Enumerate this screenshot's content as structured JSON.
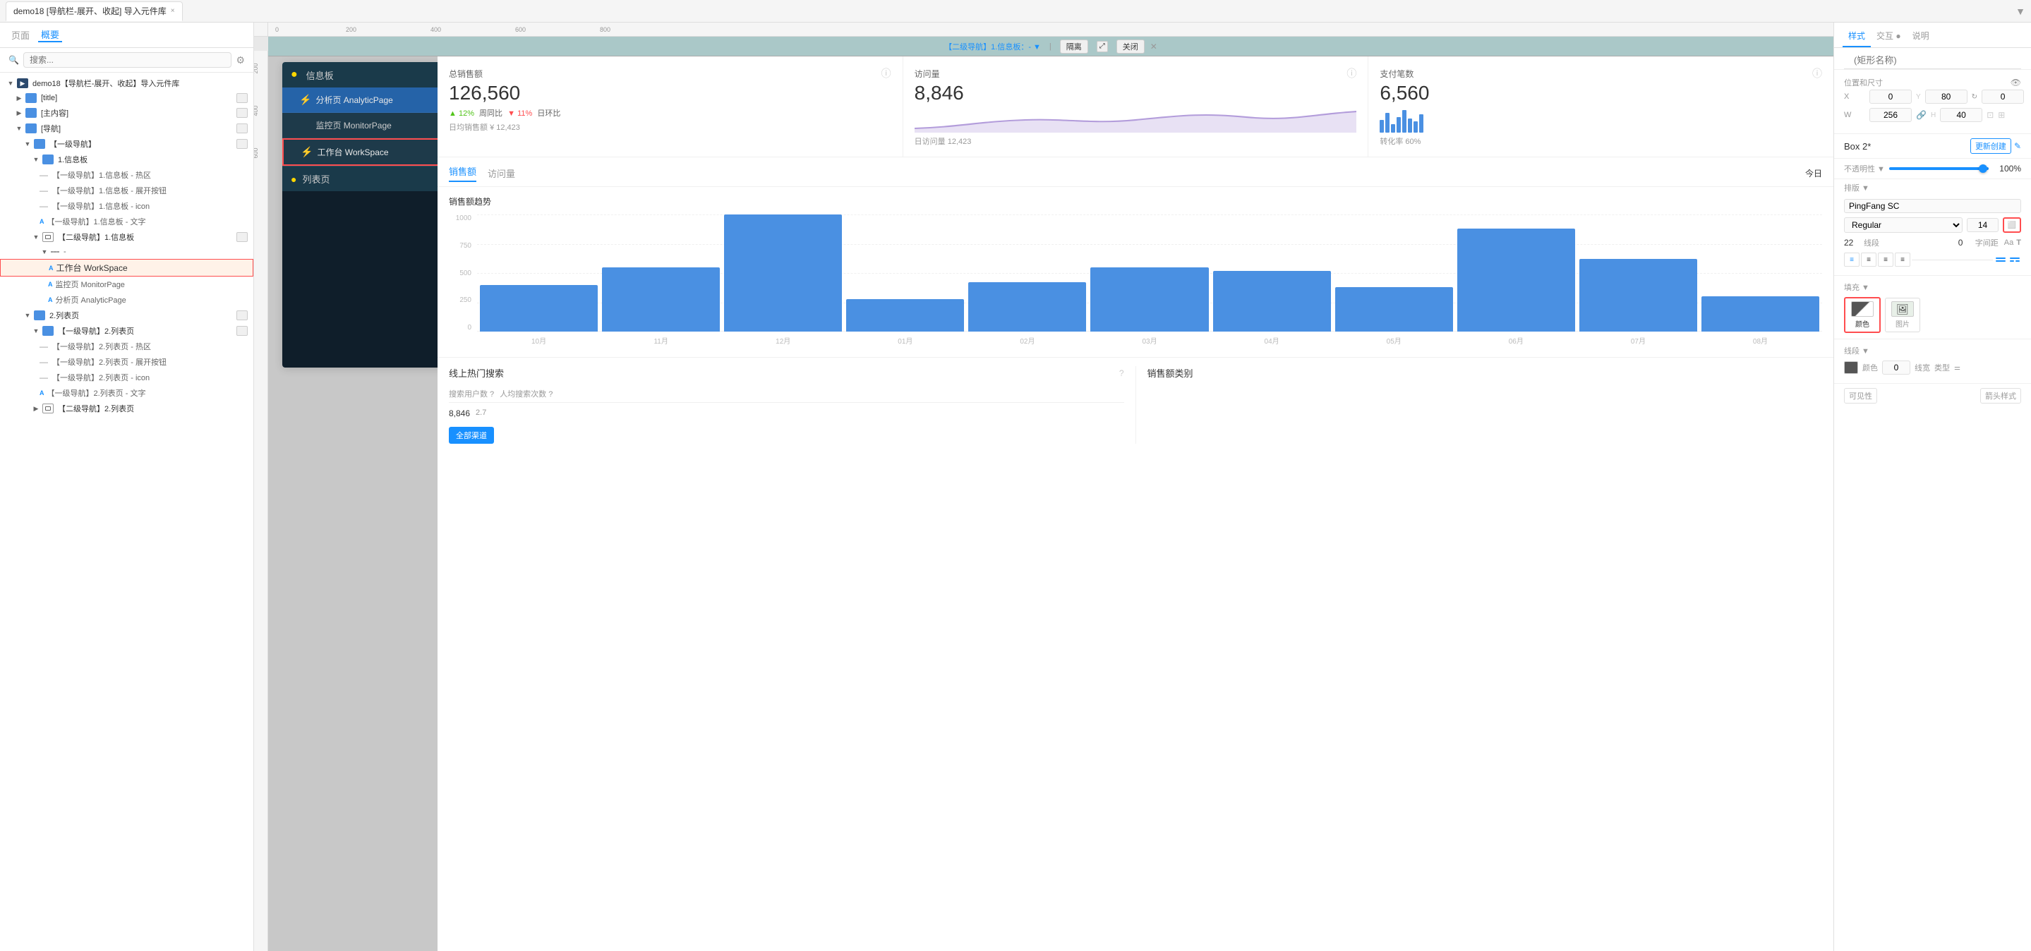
{
  "tabs": {
    "items": [
      {
        "label": "demo18 [导航栏-展开、收起] 导入元件库",
        "active": true
      }
    ],
    "close_label": "×",
    "arrow_label": "▼"
  },
  "left_panel": {
    "tabs": [
      "页面",
      "概要"
    ],
    "active_tab": "概要",
    "search_placeholder": "搜索...",
    "tree": [
      {
        "id": "root",
        "indent": 0,
        "type": "folder",
        "label": "demo18【导航栏-展开、收起】导入元件库",
        "expanded": true,
        "has_badge": true
      },
      {
        "id": "title",
        "indent": 1,
        "type": "folder",
        "label": "[title]",
        "expanded": false,
        "has_badge": true
      },
      {
        "id": "main",
        "indent": 1,
        "type": "folder",
        "label": "[主内容]",
        "expanded": false,
        "has_badge": true
      },
      {
        "id": "nav",
        "indent": 1,
        "type": "folder",
        "label": "[导航]",
        "expanded": true,
        "has_badge": true
      },
      {
        "id": "nav1",
        "indent": 2,
        "type": "folder",
        "label": "【一级导航】",
        "expanded": true,
        "has_badge": true
      },
      {
        "id": "nav1-info",
        "indent": 3,
        "type": "folder",
        "label": "1.信息板",
        "expanded": true,
        "has_badge": false
      },
      {
        "id": "nav1-info-hotzone",
        "indent": 4,
        "type": "item",
        "label": "【一级导航】1.信息板 - 热区"
      },
      {
        "id": "nav1-info-expand",
        "indent": 4,
        "type": "item",
        "label": "【一级导航】1.信息板 - 展开按钮"
      },
      {
        "id": "nav1-info-icon",
        "indent": 4,
        "type": "item",
        "label": "【一级导航】1.信息板 - icon"
      },
      {
        "id": "nav1-info-text",
        "indent": 4,
        "type": "text",
        "label": "【一级导航】1.信息板 - 文字"
      },
      {
        "id": "nav2-info",
        "indent": 3,
        "type": "compound",
        "label": "【二级导航】1.信息板",
        "expanded": true
      },
      {
        "id": "nav2-info-dash",
        "indent": 4,
        "type": "dash",
        "label": "-"
      },
      {
        "id": "ws",
        "indent": 5,
        "type": "text-selected",
        "label": "工作台 WorkSpace",
        "selected": true
      },
      {
        "id": "monitor",
        "indent": 5,
        "type": "text",
        "label": "监控页 MonitorPage"
      },
      {
        "id": "analytic",
        "indent": 5,
        "type": "text",
        "label": "分析页 AnalyticPage"
      },
      {
        "id": "list-section",
        "indent": 2,
        "type": "folder",
        "label": "2.列表页",
        "expanded": true,
        "has_badge": true
      },
      {
        "id": "nav1-list",
        "indent": 3,
        "type": "folder",
        "label": "【一级导航】2.列表页",
        "expanded": true,
        "has_badge": true
      },
      {
        "id": "nav1-list-hotzone",
        "indent": 4,
        "type": "item",
        "label": "【一级导航】2.列表页 - 热区"
      },
      {
        "id": "nav1-list-expand",
        "indent": 4,
        "type": "item",
        "label": "【一级导航】2.列表页 - 展开按钮"
      },
      {
        "id": "nav1-list-icon",
        "indent": 4,
        "type": "item",
        "label": "【一级导航】2.列表页 - icon"
      },
      {
        "id": "nav1-list-text",
        "indent": 4,
        "type": "text",
        "label": "【一级导航】2.列表页 - 文字"
      },
      {
        "id": "nav2-list",
        "indent": 3,
        "type": "compound",
        "label": "【二级导航】2.列表页"
      }
    ]
  },
  "canvas": {
    "ruler_marks": [
      "0",
      "200",
      "400",
      "600",
      "800"
    ],
    "info_bar_title": "【二级导航】1.信息板：- ▼",
    "isolate_btn": "隔离",
    "close_btn": "关闭"
  },
  "nav_preview": {
    "header": {
      "icon": "⚡",
      "title": "信息板",
      "arrow": "∧"
    },
    "analytic": {
      "text": "分析页 AnalyticPage",
      "badge": "⚡"
    },
    "monitor": {
      "text": "监控页 MonitorPage"
    },
    "workspace": {
      "text": "工作台 WorkSpace",
      "badge": "⚡"
    },
    "list_header": {
      "icon": "⚡",
      "title": "列表页",
      "arrow": "∨"
    },
    "sub_items": [
      {
        "text": "分析页 AnalyticPage"
      },
      {
        "text": "监控页 MonitorPage"
      },
      {
        "text": "工作台 WorkSpace"
      }
    ]
  },
  "stats": [
    {
      "name": "总销售额",
      "value": "126,560",
      "change_up": "12%",
      "change_label": "周同比",
      "change_down": "11%",
      "change_label2": "日环比",
      "sub": "日均销售额",
      "sub_val": "¥ 12,423"
    },
    {
      "name": "访问量",
      "value": "8,846",
      "sub": "日访问量",
      "sub_val": "12,423"
    },
    {
      "name": "支付笔数",
      "value": "6,560",
      "sub": "转化率",
      "sub_val": "60%"
    }
  ],
  "chart": {
    "tabs": [
      "销售额",
      "访问量"
    ],
    "active_tab": "销售额",
    "today_label": "今日",
    "title": "销售额趋势",
    "bars": [
      {
        "month": "10月",
        "height": 40
      },
      {
        "month": "11月",
        "height": 55
      },
      {
        "month": "12月",
        "height": 100
      },
      {
        "month": "01月",
        "height": 28
      },
      {
        "month": "02月",
        "height": 42
      },
      {
        "month": "03月",
        "height": 55
      },
      {
        "month": "04月",
        "height": 52
      },
      {
        "month": "05月",
        "height": 38
      },
      {
        "month": "06月",
        "height": 88
      },
      {
        "month": "07月",
        "height": 62
      },
      {
        "month": "08月",
        "height": 30
      }
    ],
    "y_labels": [
      "1000",
      "750",
      "500",
      "250",
      "0"
    ],
    "bottom_title1": "线上热门搜索",
    "bottom_title2": "销售额类别",
    "all_channels": "全部渠道",
    "table_headers": [
      "搜索用户数 ?",
      "人均搜索次数 ?"
    ],
    "bottom_val": "8,846"
  },
  "right_panel": {
    "tabs": [
      "样式",
      "交互 ●",
      "说明"
    ],
    "active_tab": "样式",
    "name_placeholder": "(矩形名称)",
    "position": {
      "x": "0",
      "y": "80",
      "y_label": "Y",
      "rotation": "0"
    },
    "size": {
      "w": "256",
      "h": "40"
    },
    "box_name": "Box 2*",
    "update_btn": "更新创建",
    "opacity_label": "不透明性 ▼",
    "opacity_val": "100%",
    "arrange_label": "排版 ▼",
    "font_family": "PingFang SC",
    "font_weight": "Regular",
    "font_size": "14",
    "line_height": "22",
    "char_spacing": "0",
    "fill_label": "填充 ▼",
    "fill_color_label": "颜色",
    "fill_image_label": "图片",
    "border_label": "线段 ▼",
    "border_color": "#555",
    "border_width": "0",
    "border_type": "类型",
    "visibility_label": "可见性",
    "arrow_label": "箭头样式"
  }
}
